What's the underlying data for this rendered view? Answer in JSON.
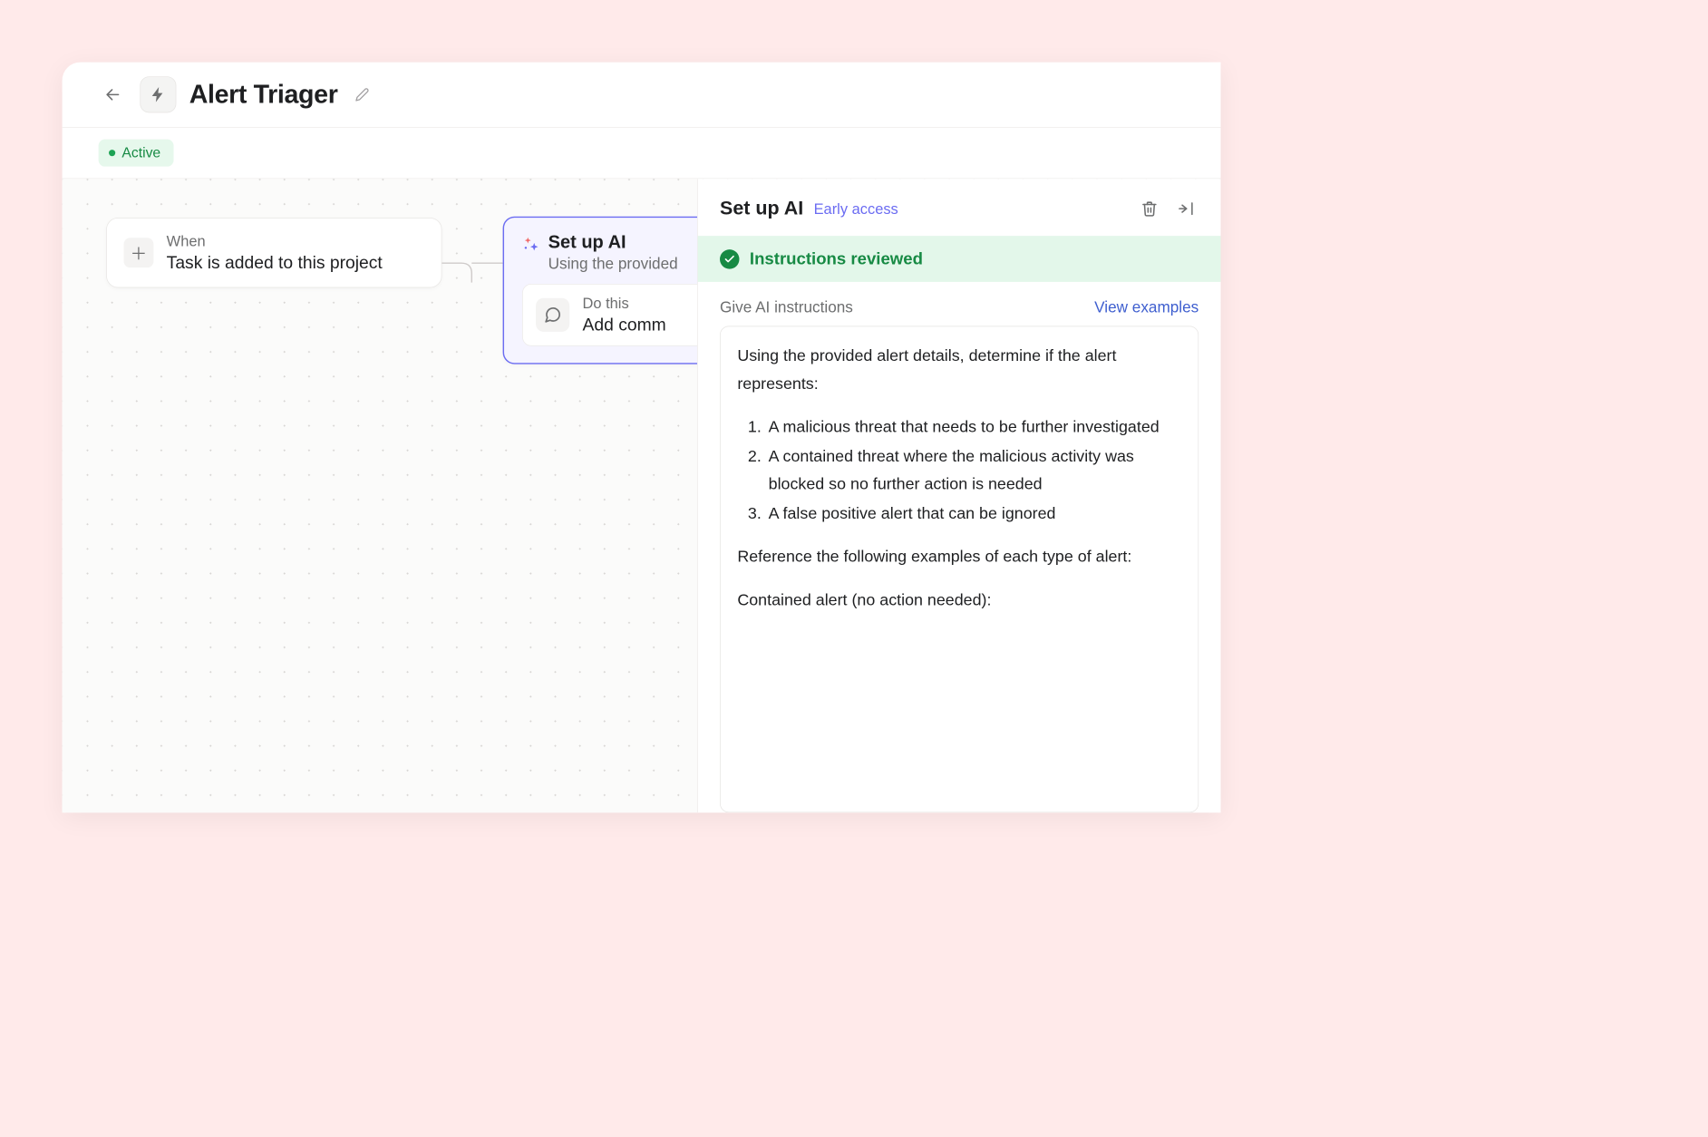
{
  "header": {
    "title": "Alert Triager"
  },
  "status": {
    "label": "Active"
  },
  "trigger": {
    "label": "When",
    "value": "Task is added to this project"
  },
  "ai_step": {
    "title": "Set up AI",
    "subtitle": "Using the provided",
    "do_label": "Do this",
    "do_value": "Add comm"
  },
  "panel": {
    "title": "Set up AI",
    "badge": "Early access",
    "review_banner": "Instructions reviewed",
    "instructions_label": "Give AI instructions",
    "view_examples": "View examples",
    "instructions": {
      "intro": "Using the provided alert details, determine if the alert represents:",
      "list": [
        "A malicious threat that needs to be further investigated",
        "A contained threat where the malicious activity was blocked so no further action is needed",
        "A false positive alert that can be ignored"
      ],
      "ref": "Reference the following examples of each type of alert:",
      "section": "Contained alert (no action needed):"
    }
  }
}
